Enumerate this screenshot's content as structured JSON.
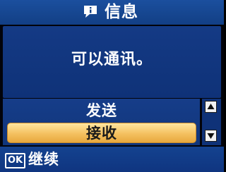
{
  "header": {
    "icon": "message-info-icon",
    "title": "信息"
  },
  "message": {
    "text": "可以通讯。"
  },
  "options": [
    {
      "label": "发送",
      "selected": false
    },
    {
      "label": "接收",
      "selected": true
    }
  ],
  "scroll": {
    "up_icon": "arrow-up-icon",
    "down_icon": "arrow-down-icon"
  },
  "footer": {
    "key_label": "OK",
    "action_label": "继续"
  },
  "colors": {
    "panel_blue": "#143a85",
    "title_blue": "#1b4f9e",
    "highlight": "#f4c060"
  }
}
